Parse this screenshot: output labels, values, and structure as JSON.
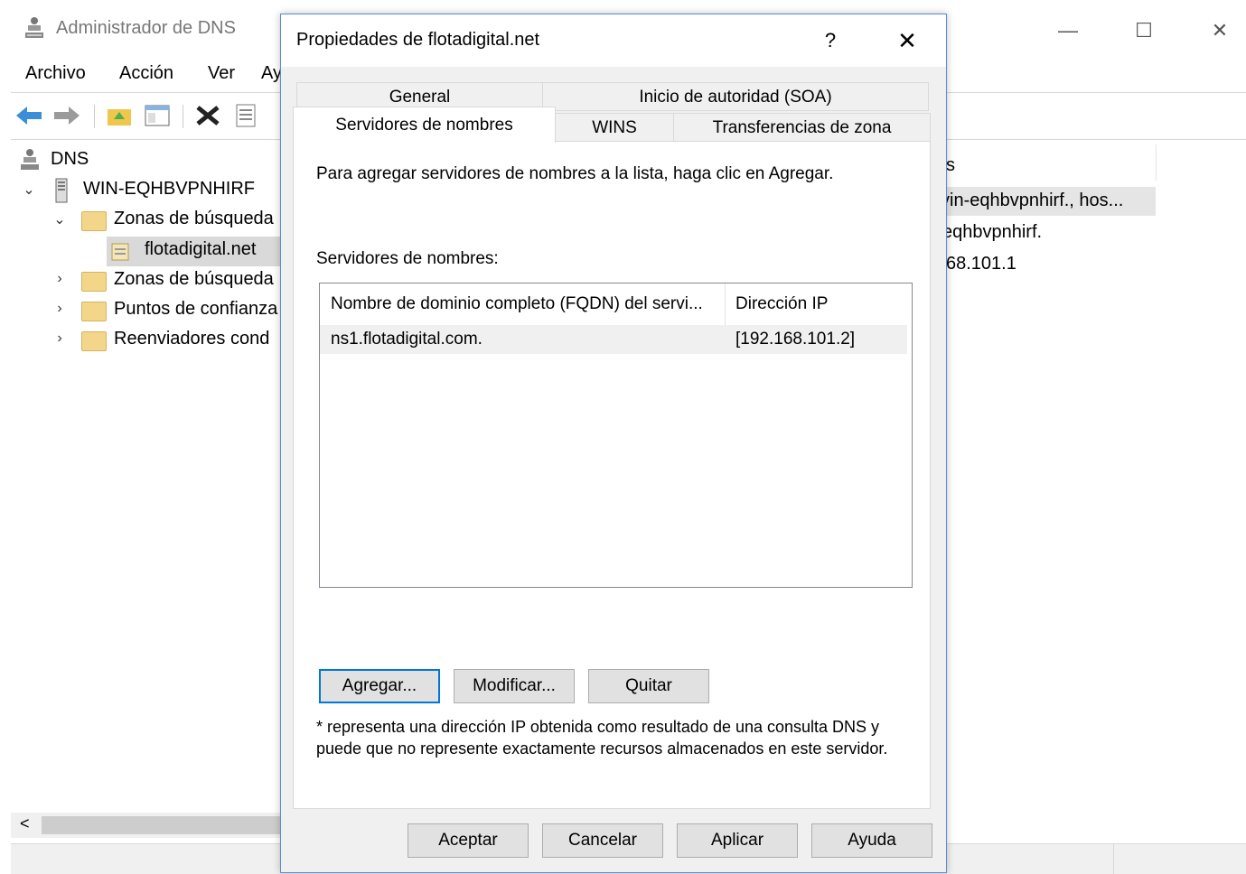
{
  "app": {
    "title": "Administrador de DNS",
    "window_controls": {
      "minimize": "—",
      "maximize": "☐",
      "close": "✕"
    },
    "menu": [
      "Archivo",
      "Acción",
      "Ver",
      "Ay"
    ],
    "tree": {
      "root": "DNS",
      "server": "WIN-EQHBVPNHIRF",
      "items": [
        {
          "label": "Zonas de búsqueda",
          "expanded": true
        },
        {
          "label": "flotadigital.net",
          "selected": true
        },
        {
          "label": "Zonas de búsqueda",
          "expanded": false
        },
        {
          "label": "Puntos de confianza",
          "expanded": false
        },
        {
          "label": "Reenviadores cond",
          "expanded": false
        }
      ]
    },
    "right_pane": {
      "header_fragment": "s",
      "rows": [
        "vin-eqhbvpnhirf., hos...",
        "eqhbvpnhirf.",
        "68.101.1"
      ]
    },
    "hscroll_left": "<"
  },
  "dialog": {
    "title": "Propiedades de flotadigital.net",
    "help_label": "?",
    "close_label": "✕",
    "tabs_row_back": [
      "General",
      "Inicio de autoridad (SOA)"
    ],
    "tabs_row_front": [
      "Servidores de nombres",
      "WINS",
      "Transferencias de zona"
    ],
    "active_tab": "Servidores de nombres",
    "instructions": "Para agregar servidores de nombres a la lista, haga clic en Agregar.",
    "list_label": "Servidores de nombres:",
    "columns": [
      "Nombre de dominio completo (FQDN) del servi...",
      "Dirección IP"
    ],
    "rows": [
      {
        "fqdn": "ns1.flotadigital.com.",
        "ip": "[192.168.101.2]"
      }
    ],
    "buttons": {
      "add": "Agregar...",
      "edit": "Modificar...",
      "remove": "Quitar"
    },
    "note": "* representa una dirección IP obtenida como resultado de una consulta DNS y puede que no represente exactamente recursos almacenados en este servidor.",
    "footer_buttons": {
      "ok": "Aceptar",
      "cancel": "Cancelar",
      "apply": "Aplicar",
      "help": "Ayuda"
    }
  },
  "colors": {
    "focus_border": "#0078d7",
    "dialog_border": "#5b8bd0",
    "folder": "#f3d68a"
  }
}
